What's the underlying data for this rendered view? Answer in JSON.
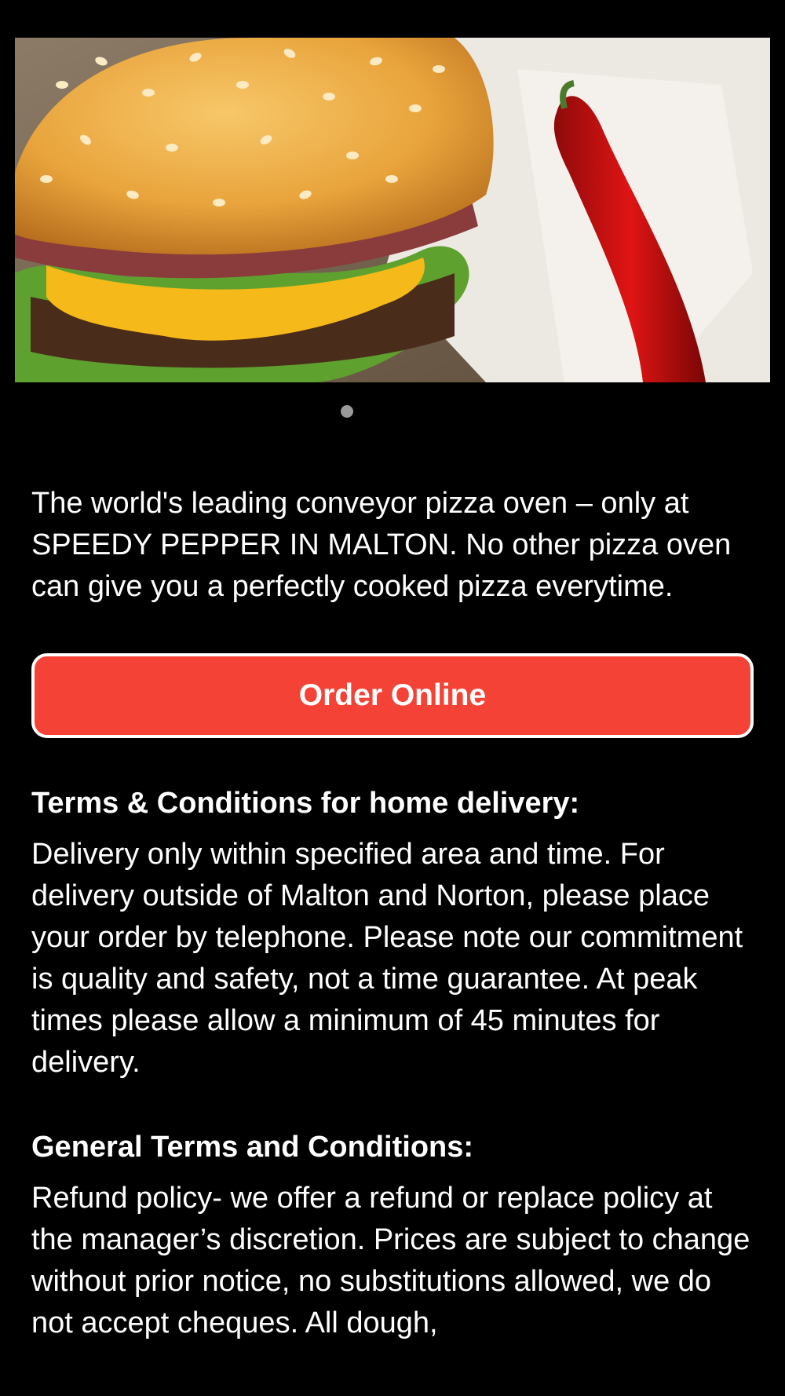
{
  "hero": {
    "image_alt": "Cheeseburger with sesame bun and a red chili pepper",
    "pager_total": 1,
    "pager_active": 1
  },
  "intro_text": "The world's leading conveyor pizza oven – only at SPEEDY PEPPER IN MALTON. No other pizza oven can give you a perfectly cooked pizza everytime.",
  "order_button": {
    "label": "Order Online",
    "color": "#f44336"
  },
  "delivery_terms": {
    "title": "Terms & Conditions for home delivery:",
    "body": "Delivery only within specified area and time. For delivery outside of Malton and Norton, please place your order by telephone. Please note our commitment is quality and safety, not a time guarantee. At peak times please allow a minimum of 45 minutes for delivery."
  },
  "general_terms": {
    "title": "General Terms and Conditions:",
    "body": "Refund policy- we offer a refund or replace policy at the manager’s discretion. Prices are subject to change without prior notice, no substitutions allowed, we do not accept cheques. All dough,"
  }
}
